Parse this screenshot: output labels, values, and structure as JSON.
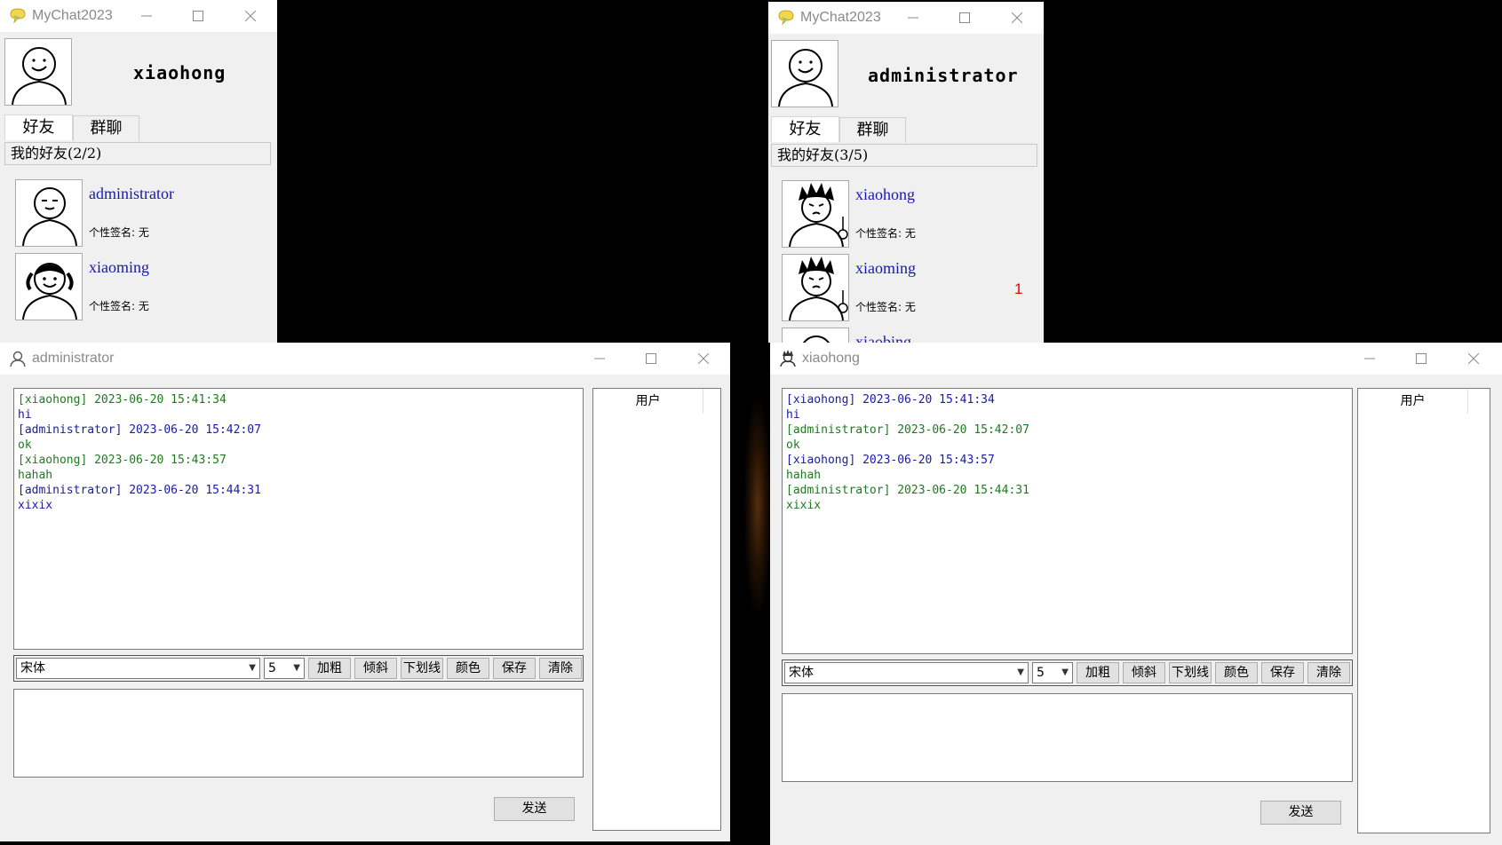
{
  "win1": {
    "title": "MyChat2023",
    "username": "xiaohong",
    "tabs": [
      "好友",
      "群聊"
    ],
    "group_header": "我的好友(2/2)",
    "friends": [
      {
        "name": "administrator",
        "signature": "个性签名: 无"
      },
      {
        "name": "xiaoming",
        "signature": "个性签名: 无"
      }
    ]
  },
  "win2": {
    "title": "MyChat2023",
    "username": "administrator",
    "tabs": [
      "好友",
      "群聊"
    ],
    "group_header": "我的好友(3/5)",
    "friends": [
      {
        "name": "xiaohong",
        "signature": "个性签名: 无",
        "badge": ""
      },
      {
        "name": "xiaoming",
        "signature": "个性签名: 无",
        "badge": "1"
      },
      {
        "name": "xiaobing",
        "signature": "",
        "badge": ""
      }
    ]
  },
  "chat1": {
    "title": "administrator",
    "messages": [
      {
        "text": "[xiaohong] 2023-06-20 15:41:34",
        "color": "#1f7a1f"
      },
      {
        "text": "hi",
        "color": "#1a1aa8"
      },
      {
        "text": "[administrator] 2023-06-20 15:42:07",
        "color": "#1a1aa8"
      },
      {
        "text": "ok",
        "color": "#1f7a1f"
      },
      {
        "text": "[xiaohong] 2023-06-20 15:43:57",
        "color": "#1f7a1f"
      },
      {
        "text": "hahah",
        "color": "#1f7a1f"
      },
      {
        "text": "[administrator] 2023-06-20 15:44:31",
        "color": "#1a1aa8"
      },
      {
        "text": "xixix",
        "color": "#1a1aa8"
      }
    ],
    "font_select": "宋体",
    "size_select": "5",
    "buttons": [
      "加粗",
      "倾斜",
      "下划线",
      "颜色",
      "保存",
      "清除"
    ],
    "send_label": "发送",
    "users_header": "用户"
  },
  "chat2": {
    "title": "xiaohong",
    "messages": [
      {
        "text": "[xiaohong] 2023-06-20 15:41:34",
        "color": "#1a1aa8"
      },
      {
        "text": "hi",
        "color": "#1a1aa8"
      },
      {
        "text": "[administrator] 2023-06-20 15:42:07",
        "color": "#1f7a1f"
      },
      {
        "text": "ok",
        "color": "#1f7a1f"
      },
      {
        "text": "[xiaohong] 2023-06-20 15:43:57",
        "color": "#1a1aa8"
      },
      {
        "text": "hahah",
        "color": "#1f7a1f"
      },
      {
        "text": "[administrator] 2023-06-20 15:44:31",
        "color": "#1f7a1f"
      },
      {
        "text": "xixix",
        "color": "#1f7a1f"
      }
    ],
    "font_select": "宋体",
    "size_select": "5",
    "buttons": [
      "加粗",
      "倾斜",
      "下划线",
      "颜色",
      "保存",
      "清除"
    ],
    "send_label": "发送",
    "users_header": "用户"
  },
  "icons": {
    "app_icon": "speech-bubble-icon",
    "chat_icon": "person-outline-icon",
    "minimize": "minimize-icon",
    "maximize": "maximize-icon",
    "close": "close-icon"
  }
}
